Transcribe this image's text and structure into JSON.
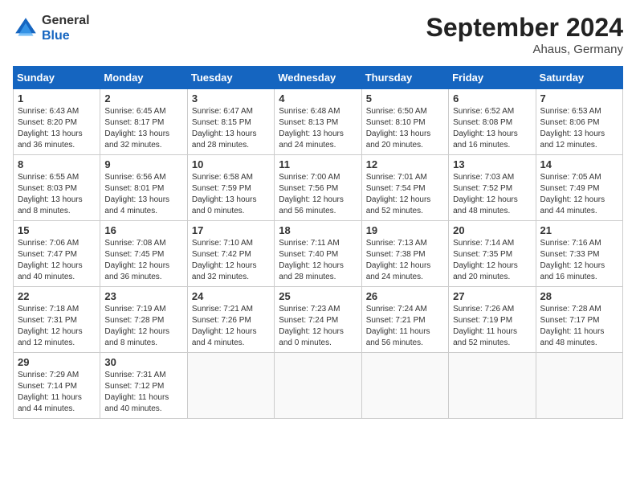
{
  "header": {
    "logo_general": "General",
    "logo_blue": "Blue",
    "month_title": "September 2024",
    "location": "Ahaus, Germany"
  },
  "days_of_week": [
    "Sunday",
    "Monday",
    "Tuesday",
    "Wednesday",
    "Thursday",
    "Friday",
    "Saturday"
  ],
  "weeks": [
    [
      {
        "day": "1",
        "info": "Sunrise: 6:43 AM\nSunset: 8:20 PM\nDaylight: 13 hours and 36 minutes."
      },
      {
        "day": "2",
        "info": "Sunrise: 6:45 AM\nSunset: 8:17 PM\nDaylight: 13 hours and 32 minutes."
      },
      {
        "day": "3",
        "info": "Sunrise: 6:47 AM\nSunset: 8:15 PM\nDaylight: 13 hours and 28 minutes."
      },
      {
        "day": "4",
        "info": "Sunrise: 6:48 AM\nSunset: 8:13 PM\nDaylight: 13 hours and 24 minutes."
      },
      {
        "day": "5",
        "info": "Sunrise: 6:50 AM\nSunset: 8:10 PM\nDaylight: 13 hours and 20 minutes."
      },
      {
        "day": "6",
        "info": "Sunrise: 6:52 AM\nSunset: 8:08 PM\nDaylight: 13 hours and 16 minutes."
      },
      {
        "day": "7",
        "info": "Sunrise: 6:53 AM\nSunset: 8:06 PM\nDaylight: 13 hours and 12 minutes."
      }
    ],
    [
      {
        "day": "8",
        "info": "Sunrise: 6:55 AM\nSunset: 8:03 PM\nDaylight: 13 hours and 8 minutes."
      },
      {
        "day": "9",
        "info": "Sunrise: 6:56 AM\nSunset: 8:01 PM\nDaylight: 13 hours and 4 minutes."
      },
      {
        "day": "10",
        "info": "Sunrise: 6:58 AM\nSunset: 7:59 PM\nDaylight: 13 hours and 0 minutes."
      },
      {
        "day": "11",
        "info": "Sunrise: 7:00 AM\nSunset: 7:56 PM\nDaylight: 12 hours and 56 minutes."
      },
      {
        "day": "12",
        "info": "Sunrise: 7:01 AM\nSunset: 7:54 PM\nDaylight: 12 hours and 52 minutes."
      },
      {
        "day": "13",
        "info": "Sunrise: 7:03 AM\nSunset: 7:52 PM\nDaylight: 12 hours and 48 minutes."
      },
      {
        "day": "14",
        "info": "Sunrise: 7:05 AM\nSunset: 7:49 PM\nDaylight: 12 hours and 44 minutes."
      }
    ],
    [
      {
        "day": "15",
        "info": "Sunrise: 7:06 AM\nSunset: 7:47 PM\nDaylight: 12 hours and 40 minutes."
      },
      {
        "day": "16",
        "info": "Sunrise: 7:08 AM\nSunset: 7:45 PM\nDaylight: 12 hours and 36 minutes."
      },
      {
        "day": "17",
        "info": "Sunrise: 7:10 AM\nSunset: 7:42 PM\nDaylight: 12 hours and 32 minutes."
      },
      {
        "day": "18",
        "info": "Sunrise: 7:11 AM\nSunset: 7:40 PM\nDaylight: 12 hours and 28 minutes."
      },
      {
        "day": "19",
        "info": "Sunrise: 7:13 AM\nSunset: 7:38 PM\nDaylight: 12 hours and 24 minutes."
      },
      {
        "day": "20",
        "info": "Sunrise: 7:14 AM\nSunset: 7:35 PM\nDaylight: 12 hours and 20 minutes."
      },
      {
        "day": "21",
        "info": "Sunrise: 7:16 AM\nSunset: 7:33 PM\nDaylight: 12 hours and 16 minutes."
      }
    ],
    [
      {
        "day": "22",
        "info": "Sunrise: 7:18 AM\nSunset: 7:31 PM\nDaylight: 12 hours and 12 minutes."
      },
      {
        "day": "23",
        "info": "Sunrise: 7:19 AM\nSunset: 7:28 PM\nDaylight: 12 hours and 8 minutes."
      },
      {
        "day": "24",
        "info": "Sunrise: 7:21 AM\nSunset: 7:26 PM\nDaylight: 12 hours and 4 minutes."
      },
      {
        "day": "25",
        "info": "Sunrise: 7:23 AM\nSunset: 7:24 PM\nDaylight: 12 hours and 0 minutes."
      },
      {
        "day": "26",
        "info": "Sunrise: 7:24 AM\nSunset: 7:21 PM\nDaylight: 11 hours and 56 minutes."
      },
      {
        "day": "27",
        "info": "Sunrise: 7:26 AM\nSunset: 7:19 PM\nDaylight: 11 hours and 52 minutes."
      },
      {
        "day": "28",
        "info": "Sunrise: 7:28 AM\nSunset: 7:17 PM\nDaylight: 11 hours and 48 minutes."
      }
    ],
    [
      {
        "day": "29",
        "info": "Sunrise: 7:29 AM\nSunset: 7:14 PM\nDaylight: 11 hours and 44 minutes."
      },
      {
        "day": "30",
        "info": "Sunrise: 7:31 AM\nSunset: 7:12 PM\nDaylight: 11 hours and 40 minutes."
      },
      {
        "day": "",
        "info": ""
      },
      {
        "day": "",
        "info": ""
      },
      {
        "day": "",
        "info": ""
      },
      {
        "day": "",
        "info": ""
      },
      {
        "day": "",
        "info": ""
      }
    ]
  ]
}
